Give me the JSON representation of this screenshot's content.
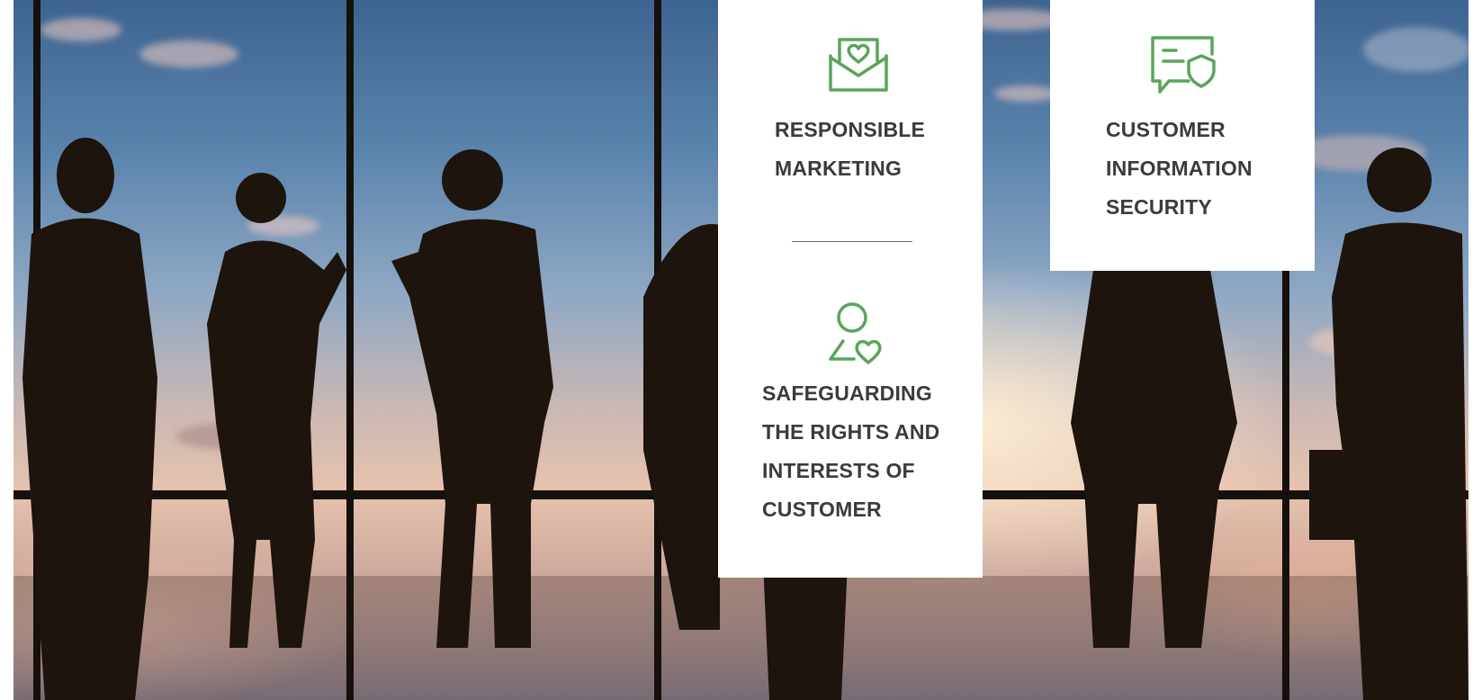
{
  "cards": {
    "responsible_marketing": {
      "icon": "envelope-heart-icon",
      "label_lines": [
        "RESPONSIBLE",
        "MARKETING"
      ]
    },
    "safeguarding_rights": {
      "icon": "person-heart-icon",
      "label_lines": [
        "SAFEGUARDING",
        "THE RIGHTS AND",
        "INTERESTS OF",
        "CUSTOMER"
      ]
    },
    "customer_information_security": {
      "icon": "chat-shield-icon",
      "label_lines": [
        "CUSTOMER",
        "INFORMATION",
        "SECURITY"
      ]
    }
  },
  "colors": {
    "accent_green": "#5aa55a",
    "label_text": "#3b3b3b",
    "card_background": "#ffffff",
    "divider": "#6e6e6e"
  },
  "background": {
    "image": "business-people-silhouettes-at-window"
  }
}
